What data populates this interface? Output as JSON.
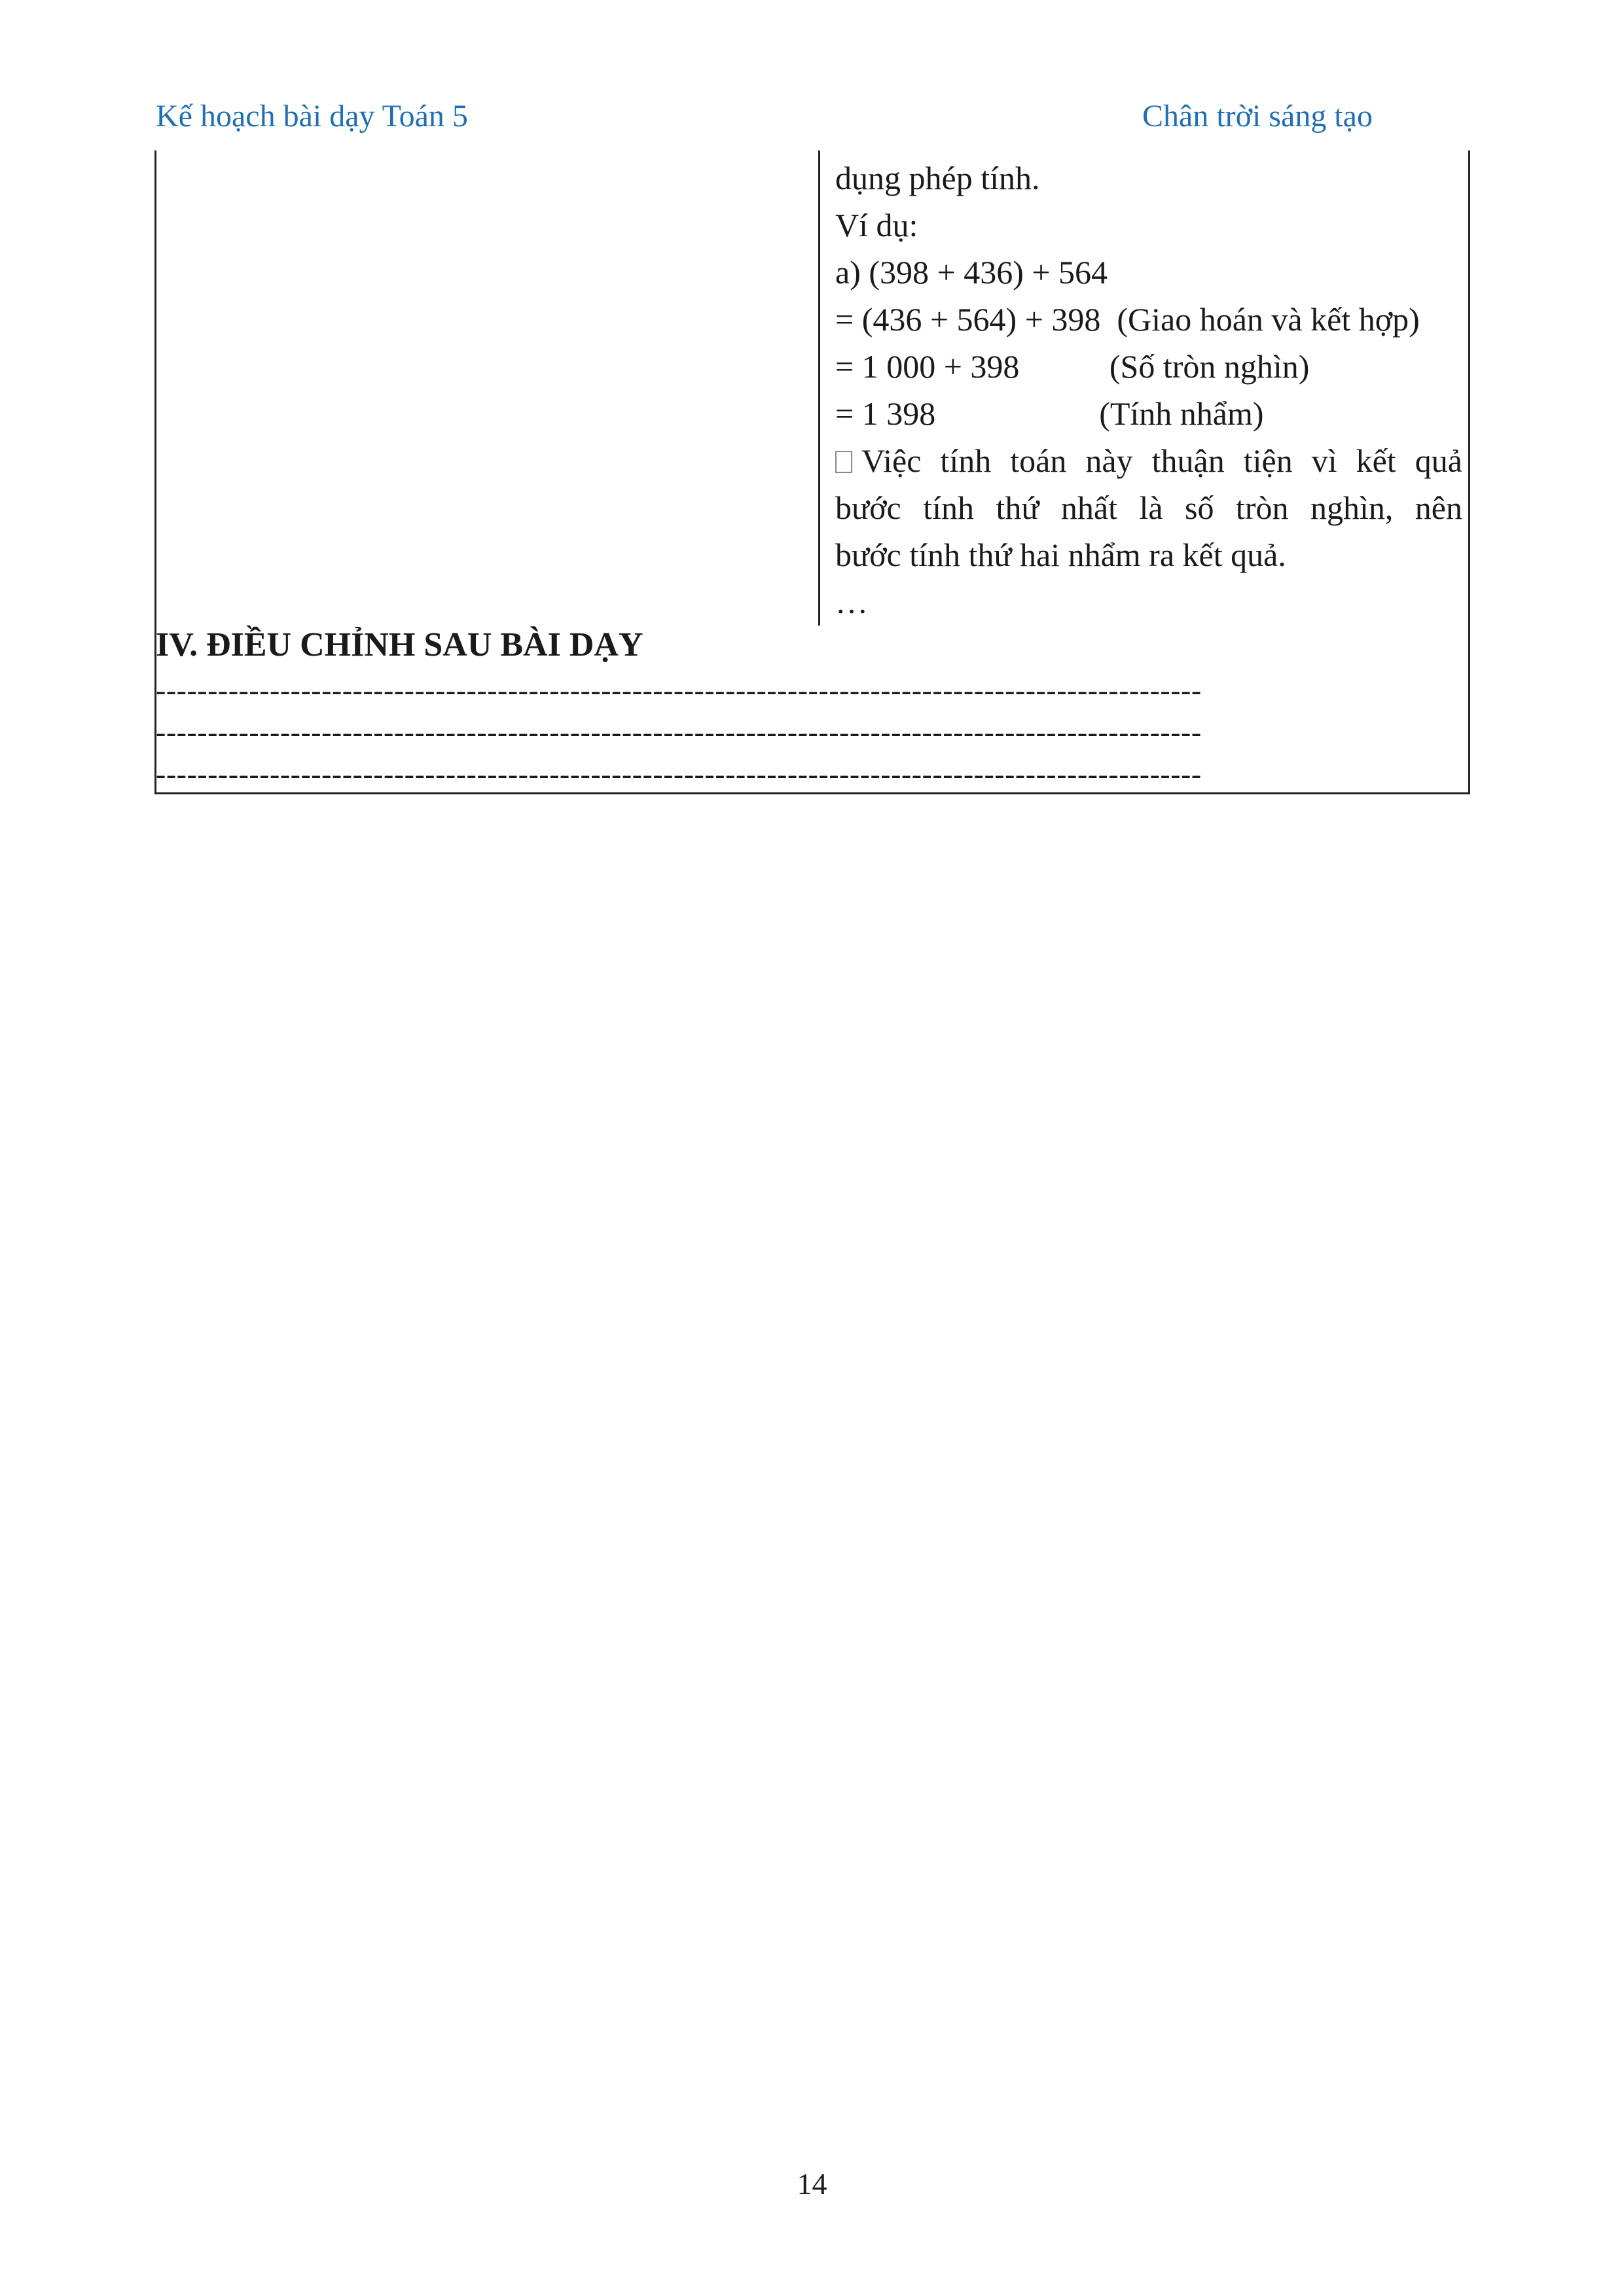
{
  "header": {
    "left": "Kế hoạch bài dạy Toán 5",
    "right": "Chân trời sáng tạo"
  },
  "content": {
    "lines": [
      "dụng phép tính.",
      "Ví dụ:",
      "a) (398 + 436) + 564",
      "= (436 + 564) + 398  (Giao hoán và kết hợp)",
      "= 1 000 + 398           (Số tròn nghìn)",
      "= 1 398                    (Tính nhẩm)"
    ],
    "note_icon": "box-glyph",
    "note_line1": "Việc tính toán này thuận tiện vì kết quả",
    "note_line2": "bước tính thứ nhất là số tròn nghìn, nên",
    "note_line3": "bước tính thứ hai nhẩm ra kết quả.",
    "ellipsis": "…"
  },
  "section": {
    "title": "IV. ĐIỀU CHỈNH SAU BÀI DẠY",
    "dash_lines": [
      "-----------------------------------------------------------------------------------------------------",
      "-----------------------------------------------------------------------------------------------------",
      "-----------------------------------------------------------------------------------------------------"
    ]
  },
  "footer": {
    "page_number": "14"
  }
}
